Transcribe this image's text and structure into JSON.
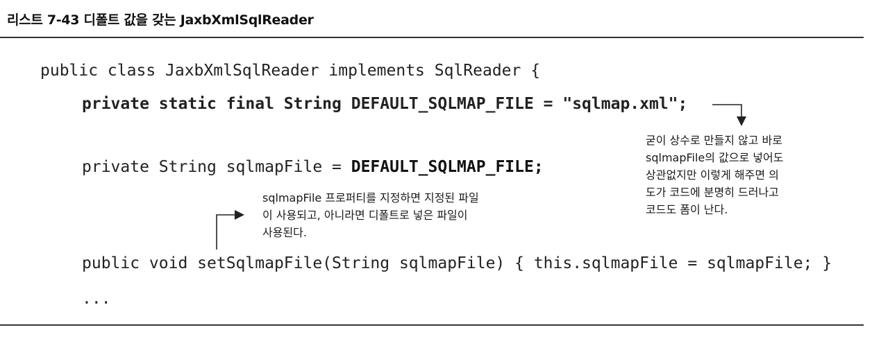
{
  "heading": "리스트 7-43 디폴트 값을 갖는 JaxbXmlSqlReader",
  "code": {
    "line1": "public class JaxbXmlSqlReader implements SqlReader {",
    "line2": "private static final String DEFAULT_SQLMAP_FILE = \"sqlmap.xml\";",
    "line3_prefix": "private String sqlmapFile = ",
    "line3_bold": "DEFAULT_SQLMAP_FILE;",
    "line4": "public void setSqlmapFile(String sqlmapFile) { this.sqlmapFile = sqlmapFile; }",
    "line5": "..."
  },
  "annotation_right": {
    "lines": [
      "굳이 상수로 만들지 않고 바로",
      "sqlmapFile의 값으로 넣어도",
      "상관없지만 이렇게 해주면 의",
      "도가 코드에 분명히 드러나고",
      "코드도 폼이 난다."
    ]
  },
  "annotation_middle": {
    "lines": [
      "sqlmapFile 프로퍼티를 지정하면 지정된 파일",
      "이 사용되고, 아니라면 디폴트로 넣은 파일이",
      "사용된다."
    ]
  }
}
